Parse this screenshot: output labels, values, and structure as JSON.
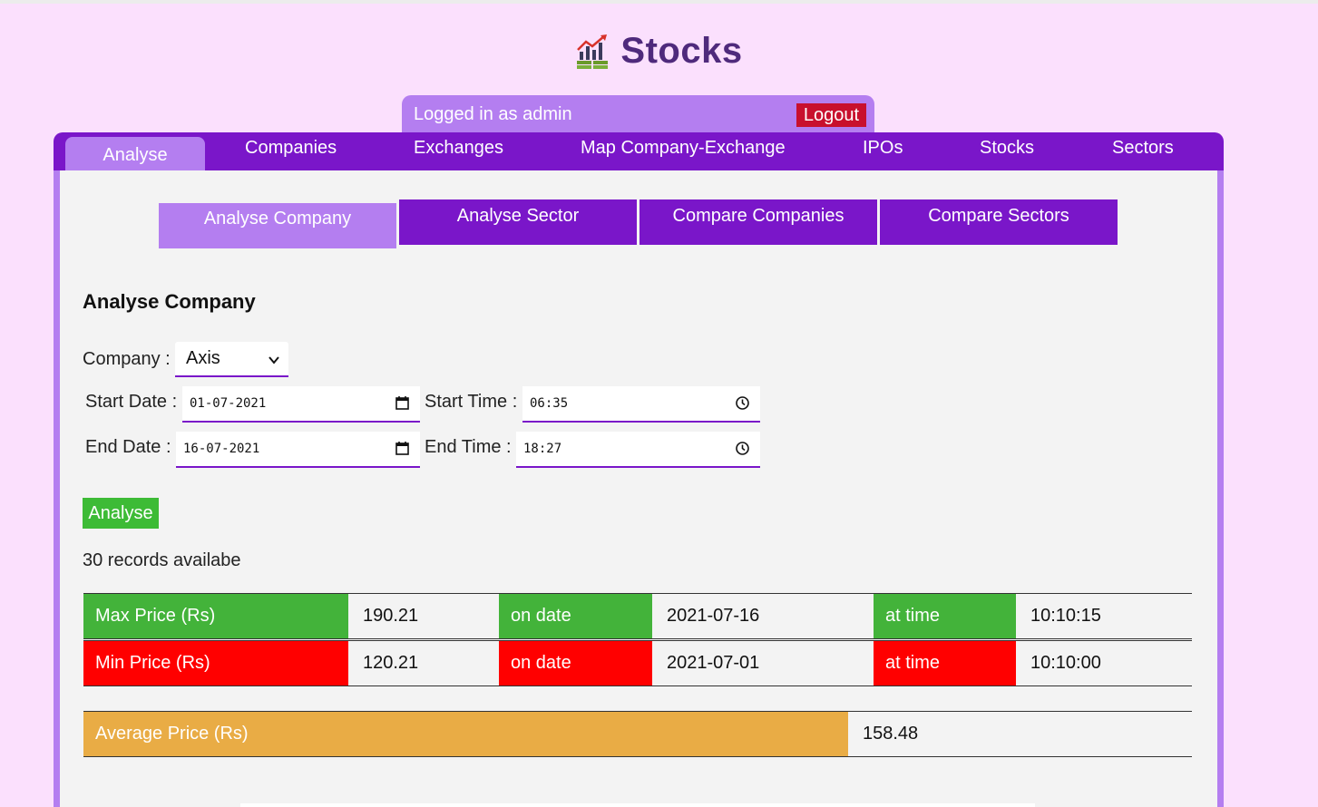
{
  "app": {
    "title": "Stocks",
    "logo_icon": "stocks-chart-icon"
  },
  "login": {
    "text": "Logged in as admin",
    "logout_label": "Logout"
  },
  "nav": {
    "tabs": [
      "Analyse",
      "Companies",
      "Exchanges",
      "Map Company-Exchange",
      "IPOs",
      "Stocks",
      "Sectors"
    ],
    "active": "Analyse"
  },
  "subtabs": [
    "Analyse Company",
    "Analyse Sector",
    "Compare Companies",
    "Compare Sectors"
  ],
  "form": {
    "title": "Analyse Company",
    "company_label": "Company :",
    "company_value": "Axis",
    "start_date_label": "Start Date :",
    "start_date_value": "01-07-2021",
    "start_time_label": "Start Time :",
    "start_time_value": "06:35",
    "end_date_label": "End Date :",
    "end_date_value": "16-07-2021",
    "end_time_label": "End Time :",
    "end_time_value": "18:27",
    "analyse_label": "Analyse"
  },
  "records_text": "30 records availabe",
  "results": {
    "max": {
      "label": "Max Price (Rs)",
      "value": "190.21",
      "on_date_label": "on date",
      "date": "2021-07-16",
      "at_time_label": "at time",
      "time": "10:10:15"
    },
    "min": {
      "label": "Min Price (Rs)",
      "value": "120.21",
      "on_date_label": "on date",
      "date": "2021-07-01",
      "at_time_label": "at time",
      "time": "10:10:00"
    },
    "avg": {
      "label": "Average Price (Rs)",
      "value": "158.48"
    }
  },
  "colors": {
    "accent": "#7a16c9",
    "accent_light": "#b47ef0",
    "max_green": "#43b33a",
    "min_red": "#ff0000",
    "avg_orange": "#e9ac45",
    "logout_red": "#c8102e"
  }
}
